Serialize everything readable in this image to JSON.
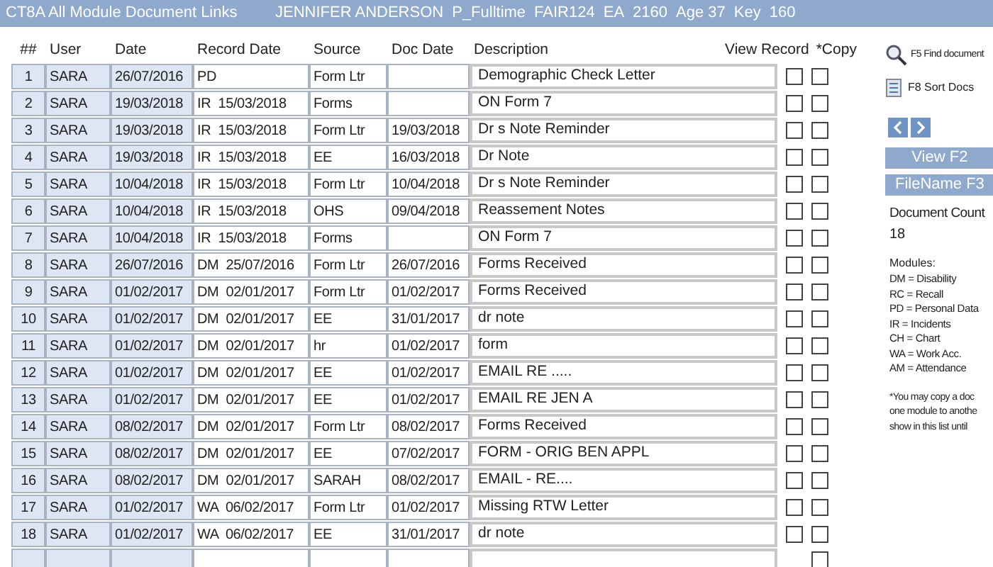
{
  "title_bar": {
    "title": "CT8A All Module Document Links",
    "fields": [
      "JENNIFER ANDERSON",
      "P_Fulltime",
      "FAIR124",
      "EA",
      "2160",
      "Age 37",
      "Key",
      "160"
    ]
  },
  "table": {
    "columns": [
      "##",
      "User",
      "Date",
      "Record Date",
      "Source",
      "Doc Date",
      "Description",
      "View Record",
      "*Copy"
    ],
    "rows": [
      {
        "num": "1",
        "user": "SARA",
        "date": "26/07/2016",
        "record_date": "PD",
        "source": "Form Ltr",
        "doc_date": null,
        "description": "Demographic Check Letter",
        "view_record": false,
        "copy": false
      },
      {
        "num": "2",
        "user": "SARA",
        "date": "19/03/2018",
        "record_date": "IR  15/03/2018",
        "source": "Forms",
        "doc_date": null,
        "description": "ON Form 7",
        "view_record": false,
        "copy": false
      },
      {
        "num": "3",
        "user": "SARA",
        "date": "19/03/2018",
        "record_date": "IR  15/03/2018",
        "source": "Form Ltr",
        "doc_date": "19/03/2018",
        "description": "Dr s Note Reminder",
        "view_record": false,
        "copy": false
      },
      {
        "num": "4",
        "user": "SARA",
        "date": "19/03/2018",
        "record_date": "IR  15/03/2018",
        "source": "EE",
        "doc_date": "16/03/2018",
        "description": "Dr Note",
        "view_record": false,
        "copy": false
      },
      {
        "num": "5",
        "user": "SARA",
        "date": "10/04/2018",
        "record_date": "IR  15/03/2018",
        "source": "Form Ltr",
        "doc_date": "10/04/2018",
        "description": "Dr s Note Reminder",
        "view_record": false,
        "copy": false
      },
      {
        "num": "6",
        "user": "SARA",
        "date": "10/04/2018",
        "record_date": "IR  15/03/2018",
        "source": "OHS",
        "doc_date": "09/04/2018",
        "description": "Reassement Notes",
        "view_record": false,
        "copy": false
      },
      {
        "num": "7",
        "user": "SARA",
        "date": "10/04/2018",
        "record_date": "IR  15/03/2018",
        "source": "Forms",
        "doc_date": null,
        "description": "ON Form 7",
        "view_record": false,
        "copy": false
      },
      {
        "num": "8",
        "user": "SARA",
        "date": "26/07/2016",
        "record_date": "DM  25/07/2016",
        "source": "Form Ltr",
        "doc_date": "26/07/2016",
        "description": "Forms Received",
        "view_record": false,
        "copy": false
      },
      {
        "num": "9",
        "user": "SARA",
        "date": "01/02/2017",
        "record_date": "DM  02/01/2017",
        "source": "Form Ltr",
        "doc_date": "01/02/2017",
        "description": "Forms Received",
        "view_record": false,
        "copy": false
      },
      {
        "num": "10",
        "user": "SARA",
        "date": "01/02/2017",
        "record_date": "DM  02/01/2017",
        "source": "EE",
        "doc_date": "31/01/2017",
        "description": "dr note",
        "view_record": false,
        "copy": false
      },
      {
        "num": "11",
        "user": "SARA",
        "date": "01/02/2017",
        "record_date": "DM  02/01/2017",
        "source": "hr",
        "doc_date": "01/02/2017",
        "description": "form",
        "view_record": false,
        "copy": false
      },
      {
        "num": "12",
        "user": "SARA",
        "date": "01/02/2017",
        "record_date": "DM  02/01/2017",
        "source": "EE",
        "doc_date": "01/02/2017",
        "description": "EMAIL RE .....",
        "view_record": false,
        "copy": false
      },
      {
        "num": "13",
        "user": "SARA",
        "date": "01/02/2017",
        "record_date": "DM  02/01/2017",
        "source": "EE",
        "doc_date": "01/02/2017",
        "description": "EMAIL RE JEN A",
        "view_record": false,
        "copy": false
      },
      {
        "num": "14",
        "user": "SARA",
        "date": "08/02/2017",
        "record_date": "DM  02/01/2017",
        "source": "Form Ltr",
        "doc_date": "08/02/2017",
        "description": "Forms Received",
        "view_record": false,
        "copy": false
      },
      {
        "num": "15",
        "user": "SARA",
        "date": "08/02/2017",
        "record_date": "DM  02/01/2017",
        "source": "EE",
        "doc_date": "07/02/2017",
        "description": "FORM - ORIG BEN APPL",
        "view_record": false,
        "copy": false
      },
      {
        "num": "16",
        "user": "SARA",
        "date": "08/02/2017",
        "record_date": "DM  02/01/2017",
        "source": "SARAH",
        "doc_date": "08/02/2017",
        "description": "EMAIL - RE....",
        "view_record": false,
        "copy": false
      },
      {
        "num": "17",
        "user": "SARA",
        "date": "01/02/2017",
        "record_date": "WA  06/02/2017",
        "source": "Form Ltr",
        "doc_date": "01/02/2017",
        "description": "Missing RTW Letter",
        "view_record": false,
        "copy": false
      },
      {
        "num": "18",
        "user": "SARA",
        "date": "01/02/2017",
        "record_date": "WA  06/02/2017",
        "source": "EE",
        "doc_date": "31/01/2017",
        "description": "dr note",
        "view_record": false,
        "copy": false
      }
    ],
    "new_row": {
      "copy": false
    }
  },
  "side_panel": {
    "find_document": "F5 Find document",
    "sort_docs": "F8 Sort Docs",
    "view_button": "View F2",
    "filename_button": "FileName F3",
    "document_count_label": "Document Count",
    "document_count": "18",
    "modules_label": "Modules:",
    "modules": [
      "DM = Disability",
      "RC = Recall",
      "PD = Personal Data",
      "IR = Incidents",
      "CH = Chart",
      "WA = Work Acc.",
      "AM = Attendance"
    ],
    "note_lines": [
      "*You may copy a doc",
      "one module to anothe",
      "show in this list until"
    ]
  }
}
